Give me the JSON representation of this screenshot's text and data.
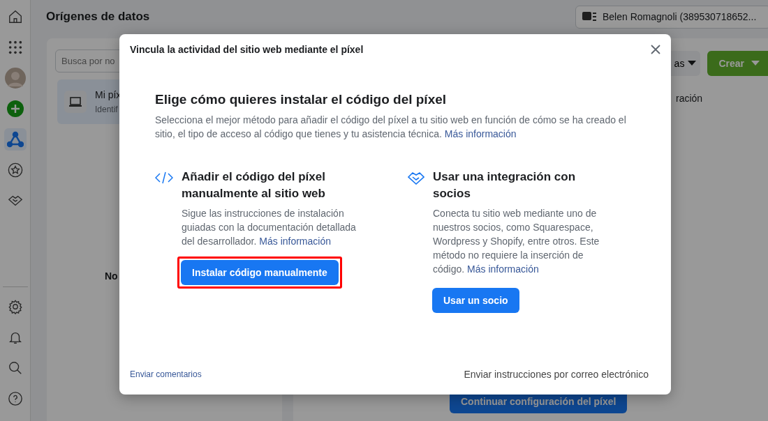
{
  "sidebar": {
    "items": [
      {
        "selected": false
      },
      {
        "selected": false
      },
      {
        "selected": false
      },
      {
        "selected": false
      },
      {
        "selected": true
      },
      {
        "selected": false
      },
      {
        "selected": false
      },
      {
        "selected": false
      },
      {
        "selected": false
      },
      {
        "selected": false
      },
      {
        "selected": false
      }
    ]
  },
  "page": {
    "title": "Orígenes de datos",
    "account": "Belen Romagnoli (389530718652..."
  },
  "left_panel": {
    "search": {
      "placeholder": "Busca por no"
    },
    "item": {
      "name": "Mi píx",
      "subtitle": "Identif",
      "selected": true
    },
    "empty_text": "No"
  },
  "right_panel": {
    "filter_button": "as",
    "create_button": "Crear",
    "tab_text": "ración",
    "continue_button": "Continuar configuración del píxel"
  },
  "dialog": {
    "title": "Vincula la actividad del sitio web mediante el píxel",
    "heading": "Elige cómo quieres instalar el código del píxel",
    "intro": "Selecciona el mejor método para añadir el código del píxel a tu sitio web en función de cómo se ha creado el sitio, el tipo de acceso al código que tienes y tu asistencia técnica.",
    "intro_link": "Más información",
    "options": [
      {
        "kind": "code",
        "title": "Añadir el código del píxel manualmente al sitio web",
        "description": "Sigue las instrucciones de instalación guiadas con la documentación detallada del desarrollador.",
        "link": "Más información",
        "button": "Instalar código manualmente",
        "highlighted": true
      },
      {
        "kind": "partner",
        "title": "Usar una integración con socios",
        "description": "Conecta tu sitio web mediante uno de nuestros socios, como Squarespace, Wordpress y Shopify, entre otros. Este método no requiere la inserción de código.",
        "link": "Más información",
        "button": "Usar un socio",
        "highlighted": false
      }
    ],
    "feedback_link": "Enviar comentarios",
    "email_link": "Enviar instrucciones por correo electrónico"
  }
}
